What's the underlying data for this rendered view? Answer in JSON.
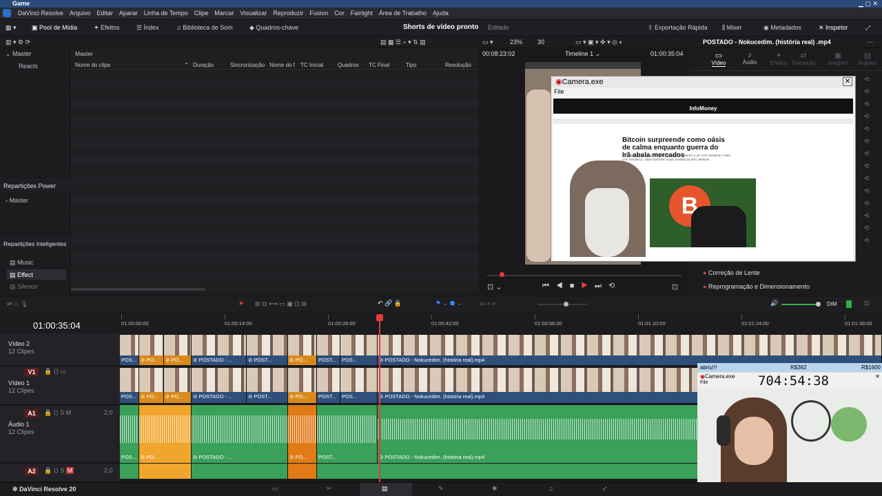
{
  "app_title": "Game",
  "menu": [
    "DaVinci Resolve",
    "Arquivo",
    "Editar",
    "Aparar",
    "Linha de Tempo",
    "Clipe",
    "Marcar",
    "Visualizar",
    "Reproduzir",
    "Fusion",
    "Cor",
    "Fairlight",
    "Área de Trabalho",
    "Ajuda"
  ],
  "toolbar": {
    "media_pool": "Pool de Mídia",
    "effects": "Efeitos",
    "index": "Índex",
    "sound_library": "Biblioteca de Som",
    "keyframes": "Quadros-chave",
    "project_title": "Shorts de vídeo pronto",
    "status": "Editado",
    "quick_export": "Exportação Rápida",
    "mixer": "Mixer",
    "metadata": "Metadados",
    "inspector": "Inspetor"
  },
  "left_panel": {
    "master": "Master",
    "reacts": "Reacts",
    "power_bins": "Repartições Power",
    "power_master": "Máster",
    "smart_bins": "Repartições Inteligentes",
    "music": "Music",
    "effect": "Effect",
    "silence": "Silence"
  },
  "pool": {
    "header": "Master",
    "columns": [
      "Nome do clipe",
      "Duração",
      "Sincronização",
      "Nome do f",
      "TC Inicial",
      "Quadros",
      "TC Final",
      "Tipo",
      "Resolução"
    ]
  },
  "viewer": {
    "zoom": "23%",
    "fps": "30",
    "timecode_left": "00:08:23:02",
    "timeline_name": "Timeline 1",
    "timecode_right": "01:00:35:04"
  },
  "inspector": {
    "clip_title": "POSTADO - Nokucedim. (história real) .mp4",
    "tabs": [
      "Vídeo",
      "Áudio",
      "Efeitos",
      "Transição",
      "Imagem",
      "Arquivo"
    ],
    "lens_correction": "Correção de Lente",
    "reframing": "Reprogramação e Dimensionamento"
  },
  "camera_window": {
    "title": "Camera.exe",
    "menu": "File",
    "site": "InfoMoney",
    "headline": "Bitcoin surpreende como oásis de calma enquanto guerra do Irã abala mercados",
    "subtext": "\"A resiliência do Bitcoin neste momento tem menos a ver com narrativa e mais com mecânica\", disse Rachael Lucas, analista da BTC Markets"
  },
  "timeline": {
    "current_tc": "01:00:35:04",
    "ruler_ticks": [
      "01:00:00:00",
      "01:00:14:00",
      "01:00:28:00",
      "01:00:42:00",
      "01:00:56:00",
      "01:01:10:00",
      "01:01:24:00",
      "01:01:38:00"
    ],
    "playhead_fraction": 0.34,
    "tracks": [
      {
        "id": "V2",
        "name": "Vídeo 2",
        "count": "12 Clipes"
      },
      {
        "id": "V1",
        "name": "Vídeo 1",
        "count": "12 Clipes"
      },
      {
        "id": "A1",
        "name": "Áudio 1",
        "count": "12 Clipes",
        "level": "2.0"
      },
      {
        "id": "A2",
        "name": "",
        "count": "",
        "level": "2.0"
      }
    ],
    "clip_short": "POS...",
    "clip_po": "PO...",
    "clip_postado": "POSTADO - ...",
    "clip_post": "POST...",
    "clip_pos2": "POST...",
    "clip_long": "POSTADO - Nokucedim. (história real).mp4",
    "dim": "DIM"
  },
  "webcam": {
    "user": "abriu!!!",
    "price1": "R$362",
    "price2": "R$1600",
    "title": "Camera.exe",
    "menu": "File",
    "timer": "704:54:38"
  },
  "bottom": {
    "version": "DaVinci Resolve 20"
  }
}
